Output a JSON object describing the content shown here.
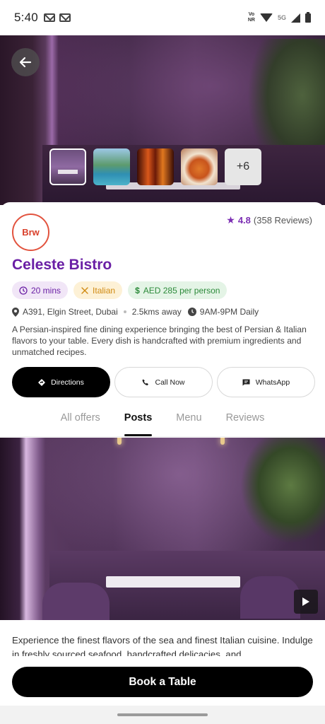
{
  "status_bar": {
    "time": "5:40",
    "volte_top": "Vo",
    "volte_bottom": "NR",
    "network": "5G"
  },
  "gallery": {
    "more_label": "+6"
  },
  "restaurant": {
    "logo_text": "Brw",
    "name": "Celeste Bistro",
    "rating": "4.8",
    "reviews": "(358 Reviews)",
    "chips": {
      "time": "20 mins",
      "cuisine": "Italian",
      "price": "AED 285 per person"
    },
    "address": "A391, Elgin Street, Dubai",
    "distance": "2.5kms away",
    "hours": "9AM-9PM Daily",
    "description": "A Persian-inspired fine dining experience bringing the best of Persian & Italian flavors to your table. Every dish is handcrafted with premium ingredients and unmatched recipes."
  },
  "actions": {
    "directions": "Directions",
    "call": "Call Now",
    "whatsapp": "WhatsApp"
  },
  "tabs": [
    "All offers",
    "Posts",
    "Menu",
    "Reviews"
  ],
  "post": {
    "text": "Experience the finest flavors of the sea and finest Italian cuisine. Indulge in freshly sourced seafood, handcrafted delicacies, and"
  },
  "book_button": "Book a Table",
  "colors": {
    "brand_purple": "#6a1fa5",
    "logo_red": "#e2533e",
    "primary_button": "#000000"
  }
}
